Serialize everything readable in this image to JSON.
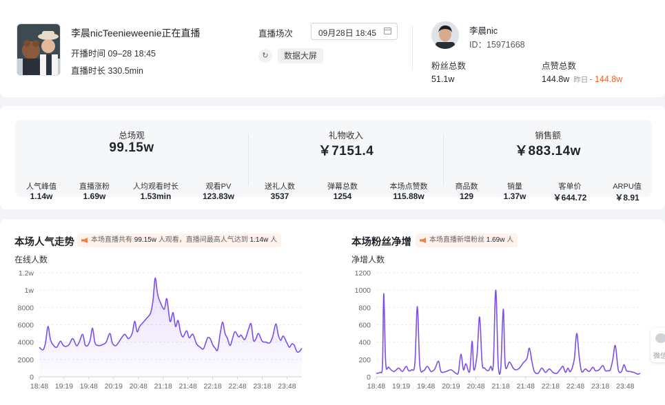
{
  "live": {
    "title": "李晨nicTeenieweenie正在直播",
    "start_label": "开播时间",
    "start_value": "09–28 18:45",
    "duration_label": "直播时长",
    "duration_value": "330.5min"
  },
  "session": {
    "label": "直播场次",
    "value": "09月28日 18:45",
    "refresh_icon": "↻",
    "bigscreen_label": "数据大屏"
  },
  "anchor": {
    "name": "李晨nic",
    "id_text": "ID：15971668",
    "fans_label": "粉丝总数",
    "fans_value": "51.1w",
    "likes_label": "点赞总数",
    "likes_value": "144.8w",
    "likes_yesterday_label": "昨日",
    "likes_yesterday_value": "- 144.8w"
  },
  "metrics": [
    {
      "title": "总场观",
      "value": "99.15w",
      "items": [
        {
          "label": "人气峰值",
          "value": "1.14w"
        },
        {
          "label": "直播涨粉",
          "value": "1.69w"
        },
        {
          "label": "人均观看时长",
          "value": "1.53min"
        },
        {
          "label": "观看PV",
          "value": "123.83w"
        }
      ]
    },
    {
      "title": "礼物收入",
      "value": "￥7151.4",
      "items": [
        {
          "label": "送礼人数",
          "value": "3537"
        },
        {
          "label": "弹幕总数",
          "value": "1254"
        },
        {
          "label": "本场点赞数",
          "value": "115.88w"
        }
      ]
    },
    {
      "title": "销售额",
      "value": "￥883.14w",
      "items": [
        {
          "label": "商品数",
          "value": "129"
        },
        {
          "label": "销量",
          "value": "1.37w"
        },
        {
          "label": "客单价",
          "value": "￥644.72"
        },
        {
          "label": "ARPU值",
          "value": "￥8.91"
        }
      ]
    }
  ],
  "charts_meta": {
    "popularity": {
      "title": "本场人气走势",
      "note_pre": "本场直播共有",
      "note_v1": "99.15w",
      "note_mid": "人观看，直播间最高人气达到",
      "note_v2": "1.14w",
      "note_post": "人"
    },
    "fans": {
      "title": "本场粉丝净增",
      "note_pre": "本场直播新增粉丝",
      "note_v1": "1.69w",
      "note_post": "人"
    }
  },
  "floating": {
    "label": "微信"
  },
  "chart_data": [
    {
      "type": "area",
      "ylabel": "在线人数",
      "y_ticks": [
        "0",
        "2000",
        "4000",
        "6000",
        "8000",
        "1w",
        "1.2w"
      ],
      "ylim": [
        0,
        12000
      ],
      "x_ticks": [
        "18:48",
        "19:19",
        "19:48",
        "20:19",
        "20:48",
        "21:18",
        "21:48",
        "22:18",
        "22:48",
        "23:18",
        "23:48"
      ],
      "x_range": [
        0,
        10.6
      ],
      "grid": true,
      "color": "#7b4dea",
      "points": [
        [
          0,
          3400
        ],
        [
          0.15,
          3100
        ],
        [
          0.25,
          3900
        ],
        [
          0.35,
          5800
        ],
        [
          0.45,
          4300
        ],
        [
          0.55,
          3700
        ],
        [
          0.7,
          3400
        ],
        [
          0.85,
          4100
        ],
        [
          0.95,
          3700
        ],
        [
          1.05,
          3500
        ],
        [
          1.2,
          3700
        ],
        [
          1.35,
          4400
        ],
        [
          1.5,
          3600
        ],
        [
          1.6,
          3900
        ],
        [
          1.75,
          4900
        ],
        [
          1.85,
          3700
        ],
        [
          1.95,
          3600
        ],
        [
          2.05,
          4200
        ],
        [
          2.15,
          5600
        ],
        [
          2.25,
          3900
        ],
        [
          2.4,
          3600
        ],
        [
          2.55,
          3700
        ],
        [
          2.7,
          4000
        ],
        [
          2.85,
          5000
        ],
        [
          2.95,
          3900
        ],
        [
          3.1,
          3600
        ],
        [
          3.3,
          4400
        ],
        [
          3.45,
          4900
        ],
        [
          3.6,
          4400
        ],
        [
          3.75,
          5000
        ],
        [
          3.85,
          6400
        ],
        [
          3.95,
          5200
        ],
        [
          4.05,
          5800
        ],
        [
          4.2,
          6300
        ],
        [
          4.35,
          6800
        ],
        [
          4.5,
          7400
        ],
        [
          4.6,
          9000
        ],
        [
          4.68,
          11400
        ],
        [
          4.78,
          9500
        ],
        [
          4.9,
          8500
        ],
        [
          5.05,
          7800
        ],
        [
          5.15,
          9000
        ],
        [
          5.28,
          6400
        ],
        [
          5.4,
          7400
        ],
        [
          5.5,
          5800
        ],
        [
          5.6,
          6500
        ],
        [
          5.7,
          5200
        ],
        [
          5.8,
          4600
        ],
        [
          5.95,
          5300
        ],
        [
          6.05,
          4500
        ],
        [
          6.2,
          4900
        ],
        [
          6.35,
          3800
        ],
        [
          6.5,
          3400
        ],
        [
          6.62,
          3200
        ],
        [
          6.72,
          3900
        ],
        [
          6.8,
          4500
        ],
        [
          6.9,
          4400
        ],
        [
          7.0,
          3700
        ],
        [
          7.1,
          3300
        ],
        [
          7.2,
          3100
        ],
        [
          7.3,
          4900
        ],
        [
          7.4,
          6300
        ],
        [
          7.5,
          5000
        ],
        [
          7.6,
          4400
        ],
        [
          7.7,
          3600
        ],
        [
          7.8,
          4400
        ],
        [
          7.9,
          5200
        ],
        [
          8.05,
          4600
        ],
        [
          8.15,
          4800
        ],
        [
          8.3,
          4300
        ],
        [
          8.45,
          5500
        ],
        [
          8.55,
          6100
        ],
        [
          8.65,
          4200
        ],
        [
          8.75,
          4400
        ],
        [
          8.85,
          5000
        ],
        [
          9.0,
          4100
        ],
        [
          9.15,
          4000
        ],
        [
          9.3,
          3900
        ],
        [
          9.42,
          4600
        ],
        [
          9.55,
          6100
        ],
        [
          9.65,
          4800
        ],
        [
          9.75,
          4200
        ],
        [
          9.85,
          4700
        ],
        [
          10.0,
          3900
        ],
        [
          10.1,
          3400
        ],
        [
          10.2,
          3800
        ],
        [
          10.3,
          3600
        ],
        [
          10.4,
          2900
        ],
        [
          10.5,
          2900
        ],
        [
          10.6,
          3300
        ]
      ]
    },
    {
      "type": "line",
      "ylabel": "净增人数",
      "y_ticks": [
        "0",
        "200",
        "400",
        "600",
        "800",
        "1000",
        "1200"
      ],
      "ylim": [
        0,
        1200
      ],
      "x_ticks": [
        "18:48",
        "19:19",
        "19:48",
        "20:19",
        "20:48",
        "21:18",
        "21:48",
        "22:18",
        "22:48",
        "23:18",
        "23:48"
      ],
      "x_range": [
        0,
        10.6
      ],
      "grid": true,
      "color": "#7b4dea",
      "points": [
        [
          0,
          40
        ],
        [
          0.15,
          50
        ],
        [
          0.25,
          120
        ],
        [
          0.3,
          960
        ],
        [
          0.38,
          160
        ],
        [
          0.5,
          110
        ],
        [
          0.7,
          60
        ],
        [
          0.9,
          100
        ],
        [
          1.05,
          60
        ],
        [
          1.2,
          120
        ],
        [
          1.3,
          70
        ],
        [
          1.42,
          80
        ],
        [
          1.55,
          150
        ],
        [
          1.65,
          810
        ],
        [
          1.75,
          130
        ],
        [
          1.9,
          70
        ],
        [
          2.05,
          120
        ],
        [
          2.2,
          60
        ],
        [
          2.35,
          90
        ],
        [
          2.5,
          180
        ],
        [
          2.6,
          60
        ],
        [
          2.8,
          60
        ],
        [
          3.0,
          80
        ],
        [
          3.2,
          40
        ],
        [
          3.3,
          50
        ],
        [
          3.4,
          260
        ],
        [
          3.5,
          80
        ],
        [
          3.6,
          150
        ],
        [
          3.75,
          60
        ],
        [
          3.85,
          410
        ],
        [
          3.92,
          80
        ],
        [
          4.05,
          260
        ],
        [
          4.15,
          690
        ],
        [
          4.25,
          160
        ],
        [
          4.35,
          100
        ],
        [
          4.5,
          70
        ],
        [
          4.6,
          120
        ],
        [
          4.7,
          130
        ],
        [
          4.8,
          1000
        ],
        [
          4.9,
          130
        ],
        [
          5.0,
          100
        ],
        [
          5.1,
          780
        ],
        [
          5.18,
          130
        ],
        [
          5.35,
          170
        ],
        [
          5.5,
          100
        ],
        [
          5.6,
          80
        ],
        [
          5.75,
          100
        ],
        [
          5.9,
          160
        ],
        [
          6.05,
          210
        ],
        [
          6.15,
          330
        ],
        [
          6.25,
          180
        ],
        [
          6.35,
          60
        ],
        [
          6.5,
          40
        ],
        [
          6.65,
          100
        ],
        [
          6.8,
          50
        ],
        [
          6.95,
          90
        ],
        [
          7.1,
          50
        ],
        [
          7.25,
          40
        ],
        [
          7.4,
          90
        ],
        [
          7.5,
          120
        ],
        [
          7.6,
          50
        ],
        [
          7.7,
          100
        ],
        [
          7.8,
          60
        ],
        [
          7.95,
          200
        ],
        [
          8.05,
          500
        ],
        [
          8.15,
          230
        ],
        [
          8.25,
          60
        ],
        [
          8.4,
          90
        ],
        [
          8.55,
          60
        ],
        [
          8.7,
          110
        ],
        [
          8.8,
          70
        ],
        [
          8.95,
          80
        ],
        [
          9.1,
          130
        ],
        [
          9.2,
          70
        ],
        [
          9.3,
          70
        ],
        [
          9.4,
          80
        ],
        [
          9.5,
          200
        ],
        [
          9.6,
          360
        ],
        [
          9.72,
          80
        ],
        [
          9.85,
          60
        ],
        [
          9.95,
          140
        ],
        [
          10.05,
          70
        ],
        [
          10.2,
          60
        ],
        [
          10.35,
          50
        ],
        [
          10.5,
          30
        ],
        [
          10.6,
          40
        ]
      ]
    }
  ]
}
